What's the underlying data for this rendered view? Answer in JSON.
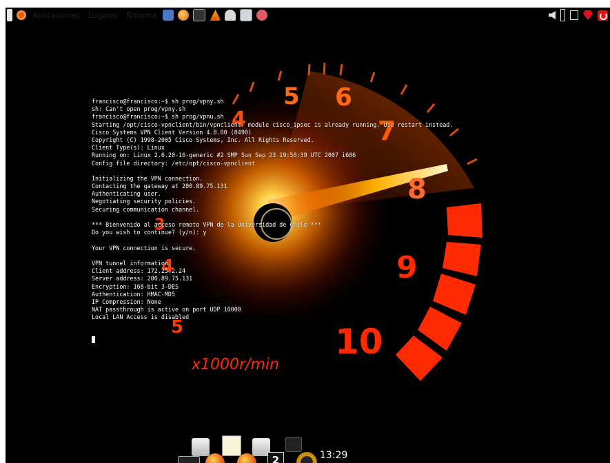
{
  "top_panel": {
    "menus": [
      "Aplicaciones",
      "Lugares",
      "Sistema"
    ],
    "launchers": [
      "help-icon",
      "firefox-icon",
      "terminal-icon",
      "vlc-icon",
      "hat-icon",
      "monitor-icon",
      "pidgin-icon"
    ],
    "tray": [
      "volume-icon",
      "battery-icon",
      "network-icon",
      "ruby-icon",
      "power-icon"
    ]
  },
  "wallpaper": {
    "gauge_numbers": [
      "4",
      "5",
      "6",
      "7",
      "8",
      "9",
      "10",
      "4",
      "5",
      "3"
    ],
    "unit_label": "x1000r/min"
  },
  "terminal": {
    "lines": [
      "francisco@francisco:~$ sh prog/vpny.sh",
      "sh: Can't open prog/vpny.sh",
      "francisco@francisco:~$ sh prog/vpnu.sh",
      "Starting /opt/cisco-vpnclient/bin/vpnclient: module cisco_ipsec is already running. Use restart instead.",
      "Cisco Systems VPN Client Version 4.8.00 (0490)",
      "Copyright (C) 1998-2005 Cisco Systems, Inc. All Rights Reserved.",
      "Client Type(s): Linux",
      "Running on: Linux 2.6.20-16-generic #2 SMP Sun Sep 23 19:50:39 UTC 2007 i686",
      "Config file directory: /etc/opt/cisco-vpnclient",
      "",
      "Initializing the VPN connection.",
      "Contacting the gateway at 200.89.75.131",
      "Authenticating user.",
      "Negotiating security policies.",
      "Securing communication channel.",
      "",
      "*** Bienvenido al acceso remoto VPN de la Universidad de Chile ***",
      "Do you wish to continue? (y/n): y",
      "",
      "Your VPN connection is secure.",
      "",
      "VPN tunnel information.",
      "Client address: 172.25.2.24",
      "Server address: 200.89.75.131",
      "Encryption: 168-bit 3-DES",
      "Authentication: HMAC-MD5",
      "IP Compression: None",
      "NAT passthrough is active on port UDP 10000",
      "Local LAN Access is disabled"
    ]
  },
  "dock": {
    "items": [
      "terminal-icon",
      "drive-icon",
      "firefox-icon",
      "notes-icon",
      "firefox-icon",
      "drive-icon",
      "calendar-icon",
      "camera-icon",
      "gauge-icon"
    ],
    "calendar_day": "2",
    "clock": "13:29"
  },
  "colors": {
    "gauge_red": "#ff2a00",
    "gauge_orange": "#ff8a00",
    "terminal_text": "#ffffff",
    "background": "#000000"
  }
}
